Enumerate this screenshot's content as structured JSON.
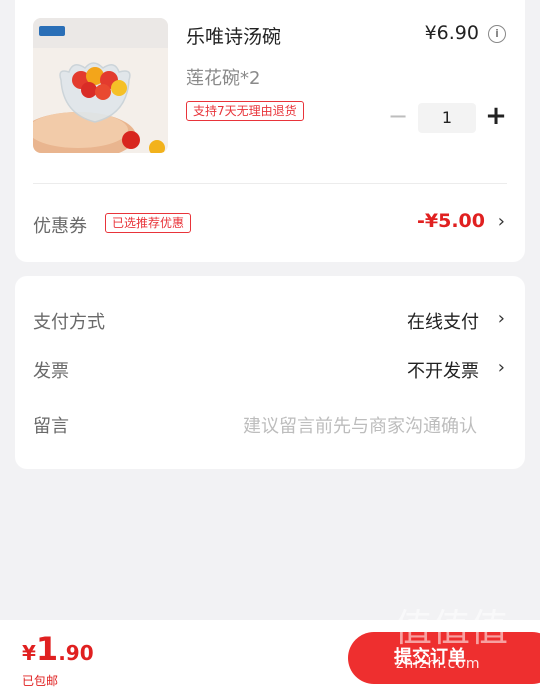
{
  "product": {
    "title": "乐唯诗汤碗",
    "spec": "莲花碗*2",
    "tag": "支持7天无理由退货",
    "price": "¥6.90",
    "info_icon": "info-icon",
    "quantity": "1",
    "minus_icon": "minus-icon",
    "plus_icon": "plus-icon",
    "thumbnail_icon": "product-thumbnail"
  },
  "coupon": {
    "label": "优惠券",
    "tag": "已选推荐优惠",
    "value": "-¥5.00",
    "chevron": "›"
  },
  "payment": {
    "method_label": "支付方式",
    "method_value": "在线支付",
    "invoice_label": "发票",
    "invoice_value": "不开发票",
    "message_label": "留言",
    "message_placeholder": "建议留言前先与商家沟通确认",
    "chevron": "›"
  },
  "bottom": {
    "currency": "¥",
    "total_int": "1",
    "total_dec": ".90",
    "shipping_note": "已包邮",
    "submit_label": "提交订单"
  },
  "watermark": {
    "logo": "值值值",
    "text": "zhizhi.com"
  },
  "colors": {
    "accent": "#e8343a",
    "price_red": "#e02020",
    "page_bg": "#f2f2f4"
  }
}
